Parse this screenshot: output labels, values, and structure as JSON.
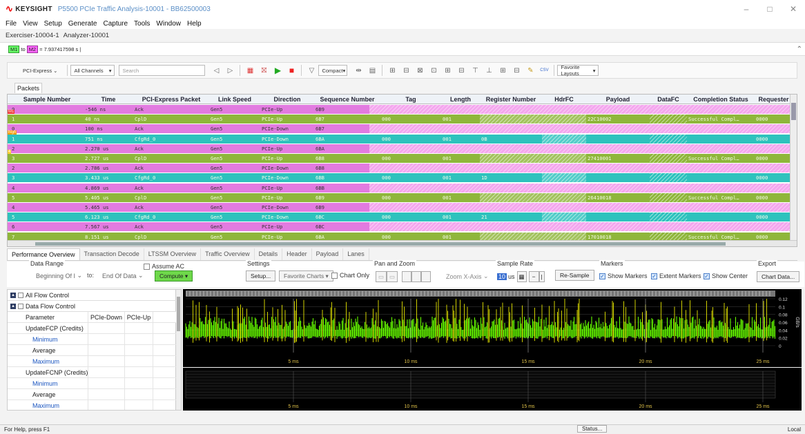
{
  "titlebar": {
    "brand": "KEYSIGHT",
    "title": "P5500 PCIe Traffic Analysis-10001 - BB62500003",
    "minimize": "–",
    "maximize": "□",
    "close": "✕"
  },
  "menu": [
    "File",
    "View",
    "Setup",
    "Generate",
    "Capture",
    "Tools",
    "Window",
    "Help"
  ],
  "doc_tabs": [
    "Exerciser-10004-1",
    "Analyzer-10001"
  ],
  "marker_bar": {
    "m1": "M1",
    "to": "to",
    "m2": "M2",
    "value": "= 7.937417598 s |"
  },
  "toolbar": {
    "protocol": "PCI-Express",
    "channels": "All Channels",
    "search_placeholder": "Search",
    "compact": "Compact",
    "favorite_layouts": "Favorite Layouts"
  },
  "packets_tab": "Packets",
  "grid": {
    "columns": [
      "Sample Number",
      "Time",
      "PCI-Express Packet",
      "Link Speed",
      "Direction",
      "Sequence Number",
      "Tag",
      "Length",
      "Register Number",
      "HdrFC",
      "Payload",
      "DataFC",
      "Completion Status",
      "Requester"
    ],
    "rows": [
      {
        "type": "ack",
        "sample": "0",
        "time": "-546 ns",
        "packet": "Ack",
        "speed": "Gen5",
        "dir": "PCIe-Up",
        "seq": "6B9",
        "tag": "",
        "length": "",
        "reg": "",
        "payload": "",
        "status": "",
        "req": ""
      },
      {
        "type": "cpl",
        "sample": "1",
        "time": "40 ns",
        "packet": "CplD",
        "speed": "Gen5",
        "dir": "PCIe-Up",
        "seq": "6B7",
        "tag": "000",
        "length": "001",
        "reg": "",
        "payload": "22C10002",
        "status": "Successful Compl…",
        "req": "0000"
      },
      {
        "type": "ack",
        "sample": "0",
        "time": "100 ns",
        "packet": "Ack",
        "speed": "Gen5",
        "dir": "PCIe-Down",
        "seq": "6B7",
        "tag": "",
        "length": "",
        "reg": "",
        "payload": "",
        "status": "",
        "req": ""
      },
      {
        "type": "cfg",
        "sample": "1",
        "time": "751 ns",
        "packet": "CfgRd_0",
        "speed": "Gen5",
        "dir": "PCIe-Down",
        "seq": "6BA",
        "tag": "000",
        "length": "001",
        "reg": "0B",
        "payload": "",
        "status": "",
        "req": "0000"
      },
      {
        "type": "ack",
        "sample": "2",
        "time": "2.270 us",
        "packet": "Ack",
        "speed": "Gen5",
        "dir": "PCIe-Up",
        "seq": "6BA",
        "tag": "",
        "length": "",
        "reg": "",
        "payload": "",
        "status": "",
        "req": ""
      },
      {
        "type": "cpl",
        "sample": "3",
        "time": "2.727 us",
        "packet": "CplD",
        "speed": "Gen5",
        "dir": "PCIe-Up",
        "seq": "6B8",
        "tag": "000",
        "length": "001",
        "reg": "",
        "payload": "27410001",
        "status": "Successful Compl…",
        "req": "0000"
      },
      {
        "type": "ack",
        "sample": "2",
        "time": "2.786 us",
        "packet": "Ack",
        "speed": "Gen5",
        "dir": "PCIe-Down",
        "seq": "6B8",
        "tag": "",
        "length": "",
        "reg": "",
        "payload": "",
        "status": "",
        "req": ""
      },
      {
        "type": "cfg",
        "sample": "3",
        "time": "3.433 us",
        "packet": "CfgRd_0",
        "speed": "Gen5",
        "dir": "PCIe-Down",
        "seq": "6BB",
        "tag": "000",
        "length": "001",
        "reg": "1D",
        "payload": "",
        "status": "",
        "req": "0000"
      },
      {
        "type": "ack",
        "sample": "4",
        "time": "4.869 us",
        "packet": "Ack",
        "speed": "Gen5",
        "dir": "PCIe-Up",
        "seq": "6BB",
        "tag": "",
        "length": "",
        "reg": "",
        "payload": "",
        "status": "",
        "req": ""
      },
      {
        "type": "cpl",
        "sample": "5",
        "time": "5.405 us",
        "packet": "CplD",
        "speed": "Gen5",
        "dir": "PCIe-Up",
        "seq": "6B9",
        "tag": "000",
        "length": "001",
        "reg": "",
        "payload": "26410018",
        "status": "Successful Compl…",
        "req": "0000"
      },
      {
        "type": "ack",
        "sample": "4",
        "time": "5.465 us",
        "packet": "Ack",
        "speed": "Gen5",
        "dir": "PCIe-Down",
        "seq": "6B9",
        "tag": "",
        "length": "",
        "reg": "",
        "payload": "",
        "status": "",
        "req": ""
      },
      {
        "type": "cfg",
        "sample": "5",
        "time": "6.123 us",
        "packet": "CfgRd_0",
        "speed": "Gen5",
        "dir": "PCIe-Down",
        "seq": "6BC",
        "tag": "000",
        "length": "001",
        "reg": "21",
        "payload": "",
        "status": "",
        "req": "0000"
      },
      {
        "type": "ack",
        "sample": "6",
        "time": "7.567 us",
        "packet": "Ack",
        "speed": "Gen5",
        "dir": "PCIe-Up",
        "seq": "6BC",
        "tag": "",
        "length": "",
        "reg": "",
        "payload": "",
        "status": "",
        "req": ""
      },
      {
        "type": "cpl",
        "sample": "7",
        "time": "8.151 us",
        "packet": "CplD",
        "speed": "Gen5",
        "dir": "PCIe-Up",
        "seq": "6BA",
        "tag": "000",
        "length": "001",
        "reg": "",
        "payload": "17010018",
        "status": "Successful Compl…",
        "req": "0000"
      }
    ],
    "side_tags": [
      "M1",
      "M1",
      "high",
      "4"
    ]
  },
  "bottom_tabs": [
    "Performance Overview",
    "Transaction Decode",
    "LTSSM Overview",
    "Traffic Overview",
    "Details",
    "Header",
    "Payload",
    "Lanes"
  ],
  "settings": {
    "data_range_title": "Data Range",
    "from_value": "Beginning Of I",
    "to_label": "to:",
    "to_value": "End Of Data",
    "compute": "Compute",
    "assume_ac": "Assume AC",
    "settings_title": "Settings",
    "setup": "Setup...",
    "favorite_charts": "Favorite Charts",
    "chart_only": "Chart Only",
    "pan_zoom_title": "Pan and Zoom",
    "zoom_x": "Zoom X-Axis",
    "sample_rate_title": "Sample Rate",
    "sample_rate_value": "10",
    "sample_rate_unit": "us",
    "resample": "Re-Sample",
    "markers_title": "Markers",
    "show_markers": "Show Markers",
    "extent_markers": "Extent Markers",
    "show_center": "Show Center",
    "export_title": "Export",
    "chart_data_btn": "Chart Data..."
  },
  "left_table": {
    "rows": [
      {
        "kind": "group",
        "label": "All Flow Control"
      },
      {
        "kind": "group",
        "label": "Data Flow Control"
      },
      {
        "kind": "header",
        "label": "Parameter",
        "c2": "PCIe-Down",
        "c3": "PCIe-Up"
      },
      {
        "kind": "section",
        "label": "UpdateFCP (Credits)"
      },
      {
        "kind": "min",
        "label": "Minimum"
      },
      {
        "kind": "sub",
        "label": "Average"
      },
      {
        "kind": "max",
        "label": "Maximum"
      },
      {
        "kind": "section",
        "label": "UpdateFCNP (Credits)"
      },
      {
        "kind": "min",
        "label": "Minimum"
      },
      {
        "kind": "sub",
        "label": "Average"
      },
      {
        "kind": "max",
        "label": "Maximum"
      }
    ]
  },
  "chart_data": {
    "type": "bar",
    "ylabel": "GB/s",
    "yticks": [
      "0.12",
      "0.1",
      "0.08",
      "0.06",
      "0.04",
      "0.02",
      "0"
    ],
    "xticks": [
      "5 ms",
      "10 ms",
      "15 ms",
      "20 ms",
      "25 ms"
    ],
    "series": [
      {
        "color": "#66ff00"
      },
      {
        "color": "#e8e800"
      }
    ]
  },
  "statusbar": {
    "help": "For Help, press F1",
    "status_btn": "Status...",
    "local": "Local"
  },
  "colors": {
    "ack": "#f4a6ee",
    "cpl": "#8fb63b",
    "cfg": "#2ec2bd"
  }
}
